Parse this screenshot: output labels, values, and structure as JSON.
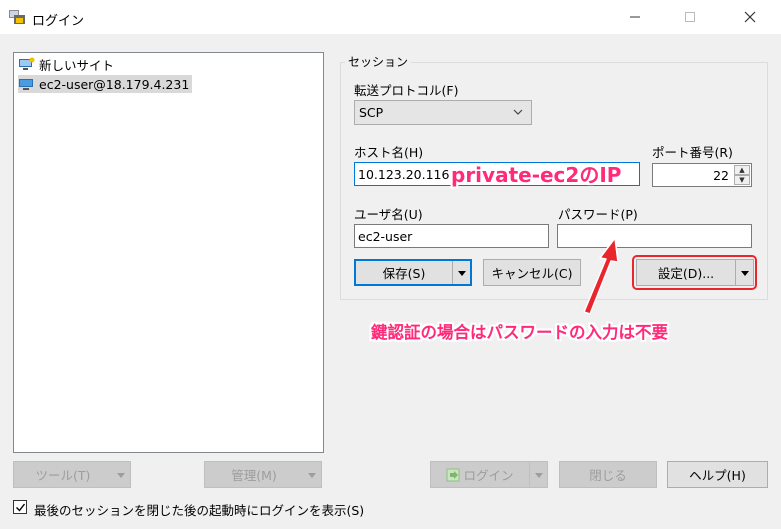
{
  "window": {
    "title": "ログイン",
    "minimize_icon": "minimize-icon",
    "maximize_icon": "maximize-icon",
    "close_icon": "close-icon"
  },
  "site_tree": {
    "items": [
      {
        "label": "新しいサイト",
        "icon": "new-site-icon",
        "selected": false
      },
      {
        "label": "ec2-user@18.179.4.231",
        "icon": "computer-icon",
        "selected": true
      }
    ]
  },
  "session": {
    "group_label": "セッション",
    "protocol_label": "転送プロトコル(F)",
    "protocol_value": "SCP",
    "host_label": "ホスト名(H)",
    "host_value": "10.123.20.116",
    "port_label": "ポート番号(R)",
    "port_value": "22",
    "user_label": "ユーザ名(U)",
    "user_value": "ec2-user",
    "password_label": "パスワード(P)",
    "password_value": "",
    "save_label": "保存(S)",
    "cancel_label": "キャンセル(C)",
    "settings_label": "設定(D)..."
  },
  "bottom": {
    "tools_label": "ツール(T)",
    "manage_label": "管理(M)",
    "login_label": "ログイン",
    "close_label": "閉じる",
    "help_label": "ヘルプ(H)",
    "show_login_label": "最後のセッションを閉じた後の起動時にログインを表示(S)",
    "show_login_checked": true
  },
  "annotations": {
    "host_note": "private-ec2のIP",
    "password_note": "鍵認証の場合はパスワードの入力は不要",
    "color": "#ff2a7a",
    "highlight_color": "#e8262c"
  },
  "colors": {
    "focus_border": "#0078d7",
    "button_face": "#e1e1e1",
    "window_bg": "#f0f0f0"
  }
}
